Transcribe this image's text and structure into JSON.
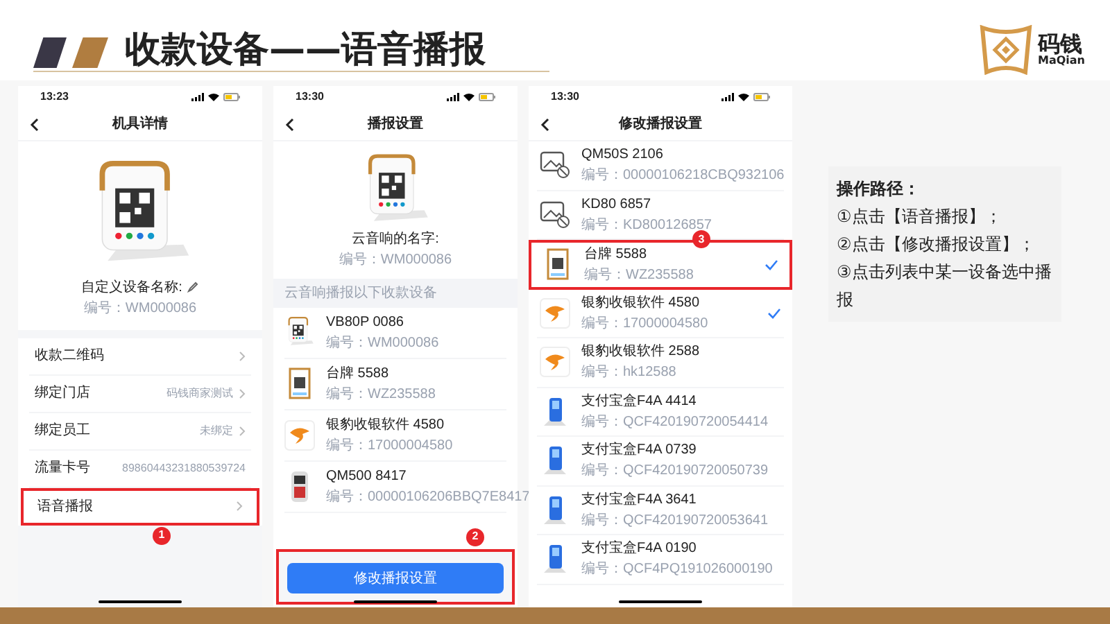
{
  "slide": {
    "title": "收款设备——语音播报"
  },
  "logo": {
    "name": "码钱",
    "latin": "MaQian"
  },
  "phones": [
    {
      "kind": "detail",
      "time": "13:23",
      "title": "机具详情",
      "device_name_label": "自定义设备名称:",
      "device_id": "编号：WM000086",
      "rows": [
        {
          "label": "收款二维码",
          "chevron": true,
          "highlighted": false
        },
        {
          "label": "绑定门店",
          "value": "码钱商家测试",
          "chevron": true,
          "highlighted": false
        },
        {
          "label": "绑定员工",
          "value": "未绑定",
          "chevron": true,
          "highlighted": false
        },
        {
          "label": "流量卡号",
          "value": "89860443231880539724",
          "chevron": false,
          "highlighted": false
        },
        {
          "label": "语音播报",
          "chevron": true,
          "highlighted": true,
          "badge": "1"
        }
      ]
    },
    {
      "kind": "settings",
      "time": "13:30",
      "title": "播报设置",
      "device_name": "云音响的名字:",
      "device_id": "编号：WM000086",
      "section": "云音响播报以下收款设备",
      "items": [
        {
          "kind": "speaker",
          "name": "VB80P 0086",
          "id": "编号：WM000086"
        },
        {
          "kind": "card",
          "name": "台牌 5588",
          "id": "编号：WZ235588"
        },
        {
          "kind": "app",
          "name": "银豹收银软件 4580",
          "id": "编号：17000004580"
        },
        {
          "kind": "pos",
          "name": "QM500 8417",
          "id": "编号：00000106206BBQ7E8417"
        }
      ],
      "button": {
        "label": "修改播报设置",
        "highlighted": true,
        "badge": "2"
      }
    },
    {
      "kind": "list",
      "time": "13:30",
      "title": "修改播报设置",
      "items": [
        {
          "kind": "missing",
          "name": "QM50S 2106",
          "id": "编号：00000106218CBQ932106",
          "checked": false,
          "highlighted": false
        },
        {
          "kind": "missing",
          "name": "KD80 6857",
          "id": "编号：KD800126857",
          "checked": false,
          "highlighted": false
        },
        {
          "kind": "card",
          "name": "台牌 5588",
          "id": "编号：WZ235588",
          "checked": true,
          "highlighted": true,
          "badge": "3"
        },
        {
          "kind": "app",
          "name": "银豹收银软件 4580",
          "id": "编号：17000004580",
          "checked": true,
          "highlighted": false
        },
        {
          "kind": "app",
          "name": "银豹收银软件 2588",
          "id": "编号：hk12588",
          "checked": false,
          "highlighted": false
        },
        {
          "kind": "box",
          "name": "支付宝盒F4A 4414",
          "id": "编号：QCF420190720054414",
          "checked": false,
          "highlighted": false
        },
        {
          "kind": "box",
          "name": "支付宝盒F4A 0739",
          "id": "编号：QCF420190720050739",
          "checked": false,
          "highlighted": false
        },
        {
          "kind": "box",
          "name": "支付宝盒F4A 3641",
          "id": "编号：QCF420190720053641",
          "checked": false,
          "highlighted": false
        },
        {
          "kind": "box",
          "name": "支付宝盒F4A 0190",
          "id": "编号：QCF4PQ191026000190",
          "checked": false,
          "highlighted": false
        }
      ]
    }
  ],
  "steps_panel": {
    "heading": "操作路径：",
    "steps": [
      "①点击【语音播报】；",
      "②点击【修改播报设置】；",
      "③点击列表中某一设备选中播报"
    ]
  }
}
